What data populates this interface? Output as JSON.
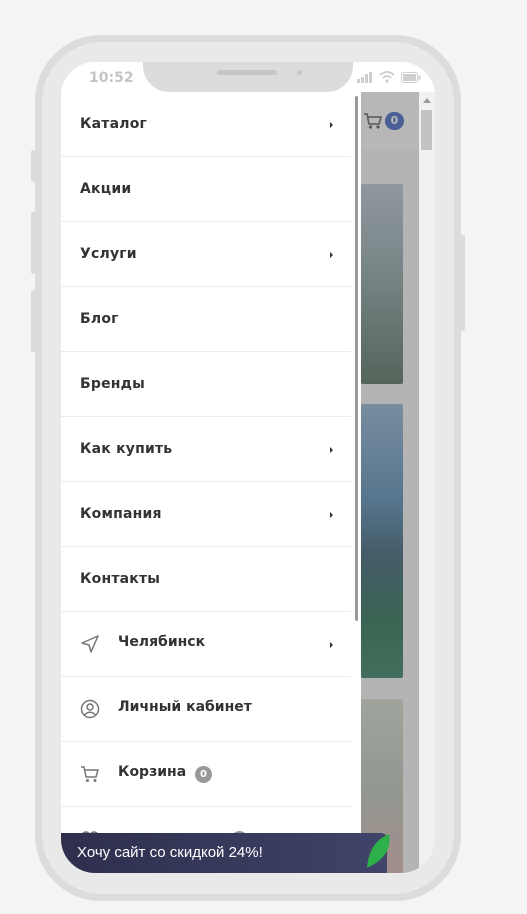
{
  "status_bar": {
    "time": "10:52"
  },
  "header": {
    "cart_count": "0"
  },
  "menu": {
    "items": [
      {
        "label": "Каталог",
        "has_submenu": true
      },
      {
        "label": "Акции",
        "has_submenu": false
      },
      {
        "label": "Услуги",
        "has_submenu": true
      },
      {
        "label": "Блог",
        "has_submenu": false
      },
      {
        "label": "Бренды",
        "has_submenu": false
      },
      {
        "label": "Как купить",
        "has_submenu": true
      },
      {
        "label": "Компания",
        "has_submenu": true
      },
      {
        "label": "Контакты",
        "has_submenu": false
      }
    ],
    "city": {
      "label": "Челябинск",
      "icon": "location-arrow-icon"
    },
    "account": {
      "label": "Личный кабинет",
      "icon": "user-circle-icon"
    },
    "cart": {
      "label": "Корзина",
      "count": "0",
      "icon": "cart-icon"
    }
  },
  "promo": {
    "text": "Хочу сайт со скидкой 24%!"
  },
  "colors": {
    "accent": "#3a5fc4",
    "promo_bg": "#2e2f4d",
    "leaf": "#2db04a"
  }
}
